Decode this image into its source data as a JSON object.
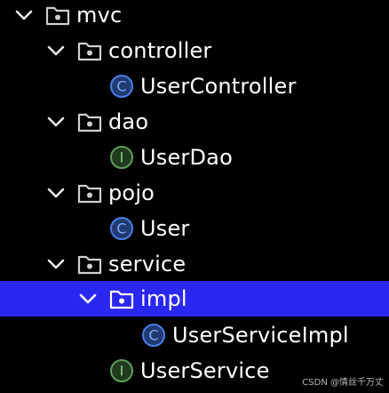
{
  "tree": {
    "mvc": "mvc",
    "controller": "controller",
    "user_controller": "UserController",
    "dao": "dao",
    "user_dao": "UserDao",
    "pojo": "pojo",
    "user": "User",
    "service": "service",
    "impl": "impl",
    "user_service_impl": "UserServiceImpl",
    "user_service": "UserService"
  },
  "colors": {
    "background": "#000000",
    "selection": "#2a28f0",
    "text": "#ffffff",
    "class_icon": "#4a7ee6",
    "interface_icon": "#5f9e5a",
    "folder_icon": "#cfcfcf"
  },
  "icons": {
    "folder": "folder-package-icon",
    "class": "java-class-icon",
    "interface": "java-interface-icon",
    "expand": "chevron-down-icon"
  },
  "watermark": "CSDN @情丝千万丈"
}
